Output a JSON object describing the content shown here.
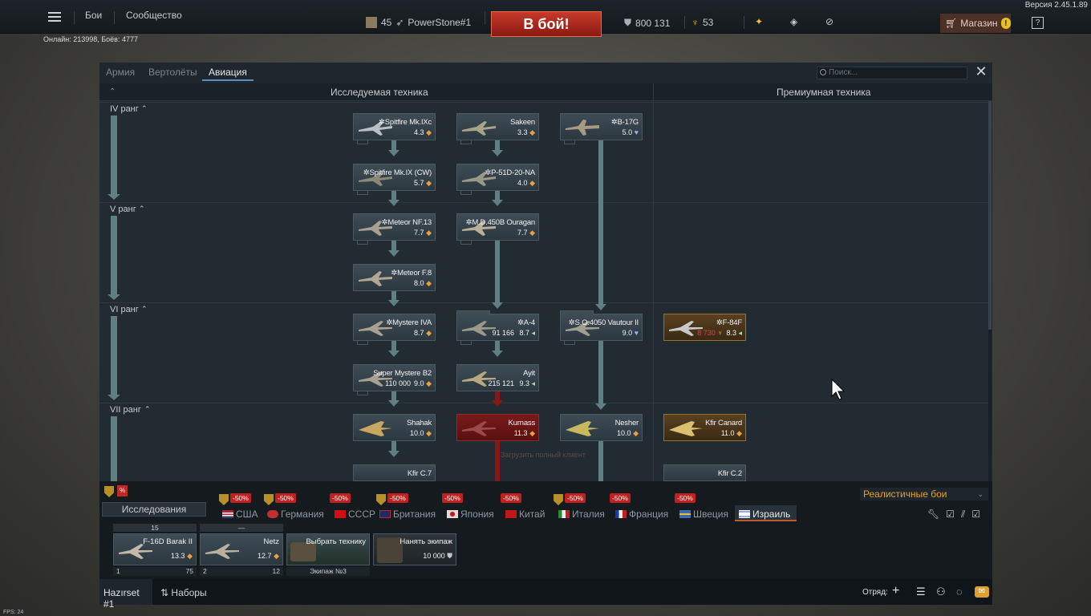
{
  "topbar": {
    "battles": "Бои",
    "community": "Сообщество",
    "player_level": "45",
    "player_name": "PowerStone#1",
    "to_battle": "В бой!",
    "silver_lions": "800 131",
    "golden_eagles": "53",
    "shop": "Магазин",
    "help": "?",
    "version": "Версия 2.45.1.89",
    "online": "Онлайн: 213998, Боёв: 4777"
  },
  "tabs": [
    "Армия",
    "Вертолёты",
    "Авиация"
  ],
  "search_placeholder": "Поиск...",
  "columns": {
    "researched": "Исследуемая техника",
    "premium": "Премиумная техника"
  },
  "ranks": [
    "IV ранг",
    "V ранг",
    "VI ранг",
    "VII ранг"
  ],
  "vehicles": [
    {
      "id": "spitfire9c",
      "name": "✲Spitfire Mk.IXc",
      "br": "4.3",
      "cost": ""
    },
    {
      "id": "sakeen",
      "name": "Sakeen",
      "br": "3.3",
      "cost": ""
    },
    {
      "id": "b17g",
      "name": "✲B-17G",
      "br": "5.0",
      "cost": ""
    },
    {
      "id": "spitfire9cw",
      "name": "✲Spitfire Mk.IX (CW)",
      "br": "5.7",
      "cost": ""
    },
    {
      "id": "p51d",
      "name": "✲P-51D-20-NA",
      "br": "4.0",
      "cost": ""
    },
    {
      "id": "meteornf13",
      "name": "✲Meteor NF.13",
      "br": "7.7",
      "cost": ""
    },
    {
      "id": "ouragan",
      "name": "✲M.D.450B Ouragan",
      "br": "7.7",
      "cost": ""
    },
    {
      "id": "meteorf8",
      "name": "✲Meteor F.8",
      "br": "8.0",
      "cost": ""
    },
    {
      "id": "mystere4a",
      "name": "✲Mystere IVA",
      "br": "8.7",
      "cost": ""
    },
    {
      "id": "a4",
      "name": "✲A-4",
      "br": "8.7",
      "cost": "91 166"
    },
    {
      "id": "vautour",
      "name": "✲S.O.4050 Vautour II",
      "br": "9.0",
      "cost": ""
    },
    {
      "id": "f84f",
      "name": "✲F-84F",
      "br": "8.3",
      "cost": "8 730"
    },
    {
      "id": "supermystere",
      "name": "Super Mystere B2",
      "br": "9.0",
      "cost": "110 000"
    },
    {
      "id": "ayit",
      "name": "Ayit",
      "br": "9.3",
      "cost": "215 121"
    },
    {
      "id": "shahak",
      "name": "Shahak",
      "br": "10.0",
      "cost": ""
    },
    {
      "id": "kurnass",
      "name": "Kurnass",
      "br": "11.3",
      "cost": ""
    },
    {
      "id": "nesher",
      "name": "Nesher",
      "br": "10.0",
      "cost": ""
    },
    {
      "id": "kfircanard",
      "name": "Kfir Canard",
      "br": "11.0",
      "cost": ""
    },
    {
      "id": "kfirc7",
      "name": "Kfir C.7",
      "br": "",
      "cost": ""
    },
    {
      "id": "kfirc2",
      "name": "Kfir C.2",
      "br": "",
      "cost": ""
    }
  ],
  "ghost_text": "Загрузить полный клиент",
  "bottom": {
    "research_btn": "Исследования",
    "mode": "Реалистичные бои",
    "discount": "-50%",
    "discount_small": "%",
    "nations": [
      "США",
      "Германия",
      "СССР",
      "Британия",
      "Япония",
      "Китай",
      "Италия",
      "Франция",
      "Швеция",
      "Израиль"
    ]
  },
  "crew": [
    {
      "head": "15",
      "name": "F-16D Barak II",
      "br": "13.3",
      "slot": "1",
      "level": "75"
    },
    {
      "head": "—",
      "name": "Netz",
      "br": "12.7",
      "slot": "2",
      "level": "12"
    },
    {
      "head": "",
      "name": "Выбрать технику",
      "br": "",
      "slot": "",
      "level": "Экипаж №3"
    },
    {
      "head": "",
      "name": "Нанять экипаж",
      "br": "10 000",
      "slot": "",
      "level": ""
    }
  ],
  "botbar": {
    "preset": "Hazırset #1",
    "presets": "Наборы",
    "squad": "Отряд:",
    "fps": "FPS: 24"
  }
}
